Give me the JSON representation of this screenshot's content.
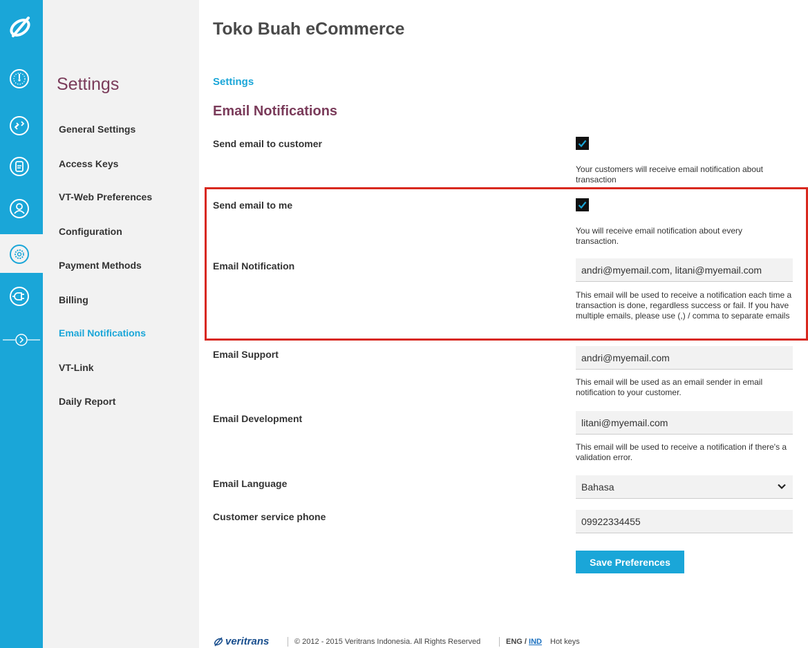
{
  "app": {
    "title": "Toko Buah eCommerce"
  },
  "rail": {
    "items": [
      {
        "icon": "dashboard-icon"
      },
      {
        "icon": "transactions-icon"
      },
      {
        "icon": "reports-icon"
      },
      {
        "icon": "user-icon"
      },
      {
        "icon": "settings-gear-icon",
        "active": true
      },
      {
        "icon": "plugin-icon"
      }
    ]
  },
  "sidebar": {
    "title": "Settings",
    "items": [
      {
        "label": "General Settings"
      },
      {
        "label": "Access Keys"
      },
      {
        "label": "VT-Web Preferences"
      },
      {
        "label": "Configuration"
      },
      {
        "label": "Payment Methods"
      },
      {
        "label": "Billing"
      },
      {
        "label": "Email Notifications",
        "active": true
      },
      {
        "label": "VT-Link"
      },
      {
        "label": "Daily Report"
      }
    ]
  },
  "main": {
    "breadcrumb": "Settings",
    "section_title": "Email Notifications",
    "send_customer": {
      "label": "Send email to customer",
      "checked": true,
      "help": "Your customers will receive email notification about transaction"
    },
    "send_me": {
      "label": "Send email to me",
      "checked": true,
      "help": "You will receive email notification about every transaction."
    },
    "email_notification": {
      "label": "Email Notification",
      "value": "andri@myemail.com, litani@myemail.com",
      "help": "This email will be used to receive a notification each time a transaction is done, regardless success or fail. If you have multiple emails, please use (,) / comma to separate emails"
    },
    "email_support": {
      "label": "Email Support",
      "value": "andri@myemail.com",
      "help": "This email will be used as an email sender in email notification to your customer."
    },
    "email_development": {
      "label": "Email Development",
      "value": "litani@myemail.com",
      "help": "This email will be used to receive a notification if there's a validation error."
    },
    "email_language": {
      "label": "Email Language",
      "selected": "Bahasa"
    },
    "cs_phone": {
      "label": "Customer service phone",
      "value": "09922334455"
    },
    "save_label": "Save Preferences",
    "highlight_color": "#d8281e"
  },
  "footer": {
    "brand": "veritrans",
    "copyright": "© 2012 - 2015 Veritrans Indonesia. All Rights Reserved",
    "lang_eng": "ENG",
    "lang_sep": "/",
    "lang_ind": "IND",
    "hot_keys": "Hot keys"
  },
  "colors": {
    "accent": "#1aa6d8",
    "title_purple": "#7a3b5a",
    "highlight": "#d8281e"
  }
}
